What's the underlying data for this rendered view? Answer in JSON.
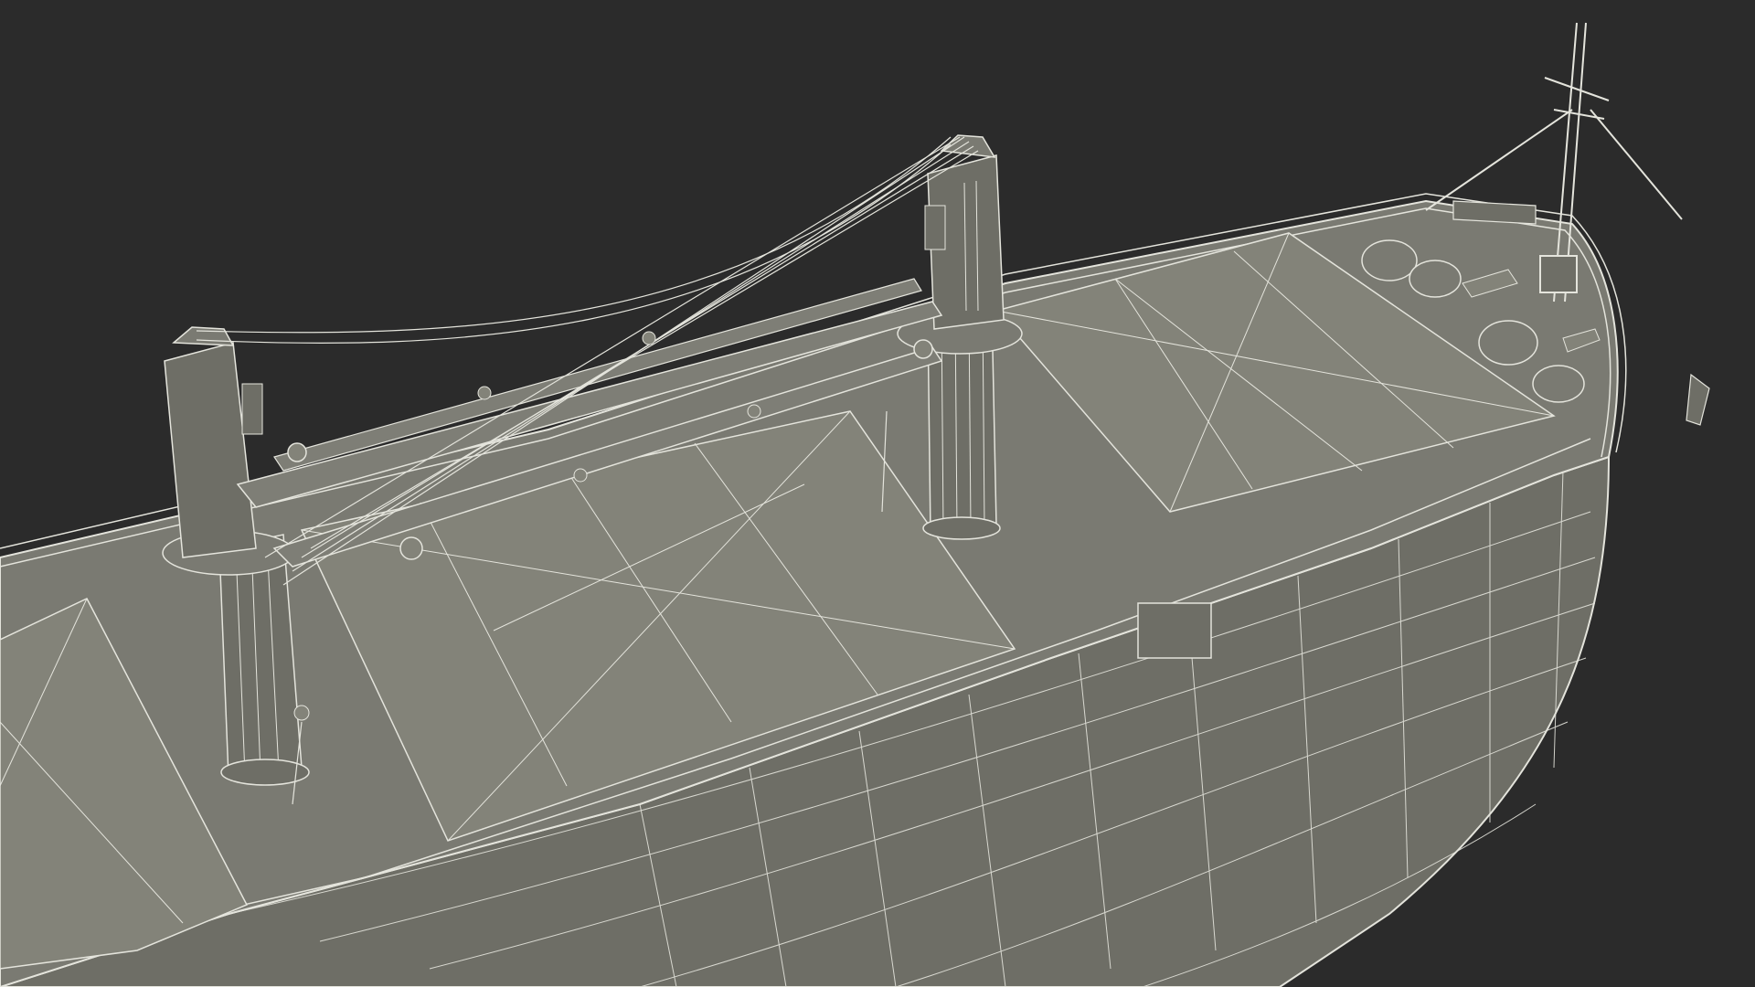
{
  "scene": {
    "subject": "bulk-carrier-ship-wireframe",
    "background_color": "#2b2b2b",
    "hull_color": "#6e6e66",
    "deck_color": "#7a7a72",
    "hatch_color": "#838379",
    "wire_color": "#e4e4dc"
  }
}
